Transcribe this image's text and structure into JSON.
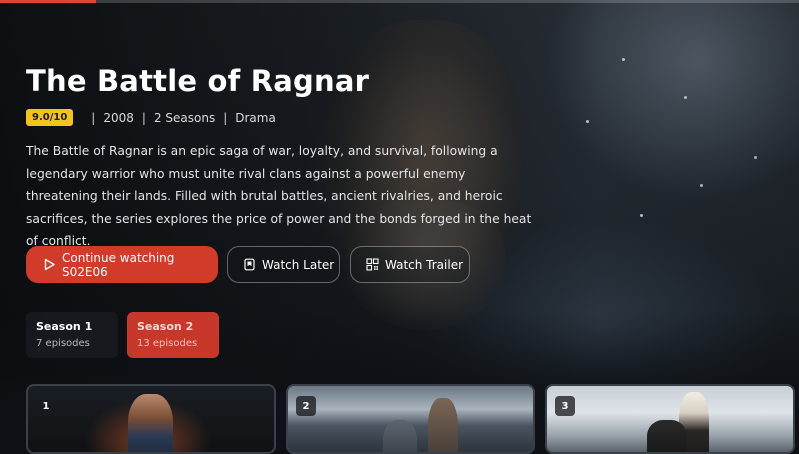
{
  "show": {
    "title": "The Battle of Ragnar",
    "rating": "9.0/10",
    "year": "2008",
    "seasons_count": "2 Seasons",
    "genre": "Drama",
    "separator": "|",
    "description": "The Battle of Ragnar is an epic saga of war, loyalty, and survival, following a legendary warrior who must unite rival clans against a powerful enemy threatening their lands. Filled with brutal battles, ancient rivalries, and heroic sacrifices, the series explores the price of power and the bonds forged in the heat of conflict."
  },
  "actions": {
    "continue_label": "Continue watching S02E06",
    "watch_later_label": "Watch Later",
    "trailer_label": "Watch Trailer"
  },
  "seasons": [
    {
      "name": "Season 1",
      "episodes": "7 episodes",
      "selected": false
    },
    {
      "name": "Season 2",
      "episodes": "13 episodes",
      "selected": true
    }
  ],
  "episodes": [
    {
      "number": "1"
    },
    {
      "number": "2"
    },
    {
      "number": "3"
    }
  ],
  "icons": {
    "play": "play-icon",
    "bookmark": "bookmark-icon",
    "qr": "qr-code-icon"
  },
  "colors": {
    "accent": "#d23a2a",
    "rating_badge": "#f3c21c"
  },
  "progress": {
    "top_bar_fraction": 0.12
  }
}
